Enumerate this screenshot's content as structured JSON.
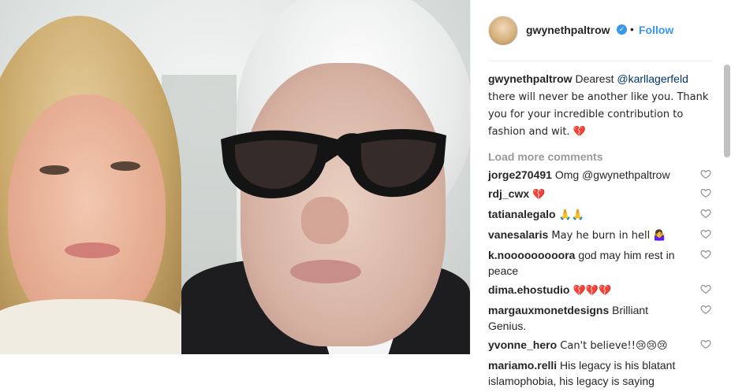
{
  "post": {
    "username": "gwynethpaltrow",
    "follow_label": "Follow",
    "separator": "•",
    "verified_icon": "verified-badge-icon",
    "caption_user": "gwynethpaltrow",
    "caption_pre": "Dearest ",
    "caption_mention": "@karllagerfeld",
    "caption_post": " there will never be another like you. Thank you for your incredible contribution to fashion and wit. 💔",
    "load_more": "Load more comments"
  },
  "comments": [
    {
      "user": "jorge270491",
      "text": " Omg @gwynethpaltrow"
    },
    {
      "user": "rdj_cwx",
      "text": " 💔"
    },
    {
      "user": "tatianalegalo",
      "text": " 🙏🙏"
    },
    {
      "user": "vanesalaris",
      "text": " May he burn in hell 🤷‍♀️"
    },
    {
      "user": "k.nooooooooora",
      "text": " god may him rest in peace"
    },
    {
      "user": "dima.ehostudio",
      "text": " 💔💔💔"
    },
    {
      "user": "margauxmonetdesigns",
      "text": " Brilliant Genius."
    },
    {
      "user": "yvonne_hero",
      "text": " Can't believe!!😢😢😢"
    },
    {
      "user": "mariamo.relli",
      "text": " His legacy is his blatant islamophobia, his legacy is saying"
    }
  ],
  "colors": {
    "link_blue": "#3897f0",
    "mention": "#003569",
    "muted": "#999999"
  }
}
